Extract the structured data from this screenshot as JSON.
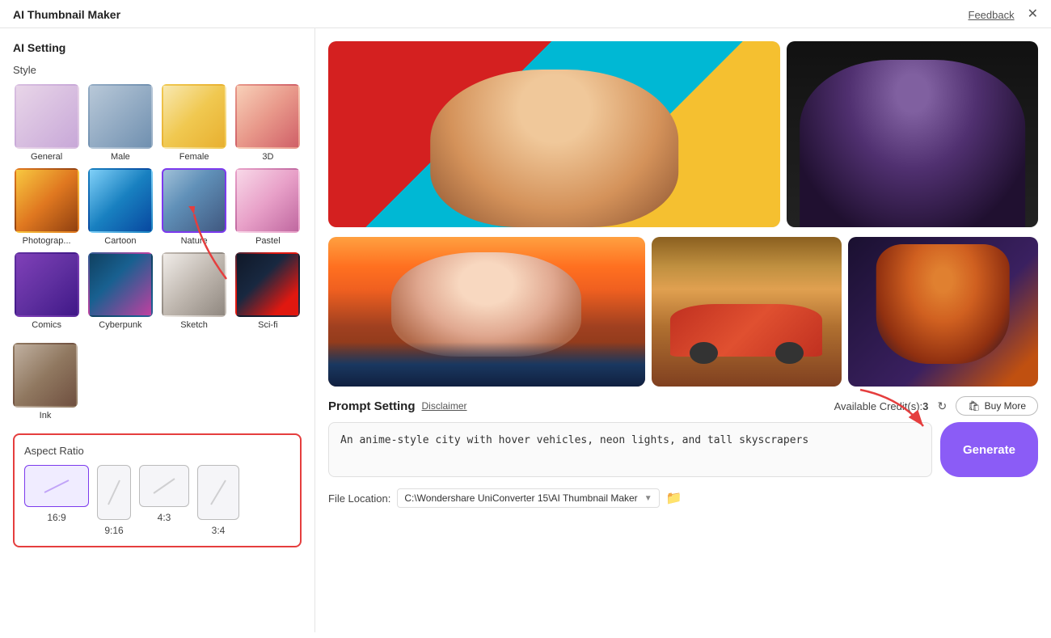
{
  "titleBar": {
    "title": "AI Thumbnail Maker",
    "feedback": "Feedback",
    "close": "✕"
  },
  "leftPanel": {
    "sectionTitle": "AI Setting",
    "styleLabel": "Style",
    "styles": [
      {
        "id": "general",
        "label": "General",
        "selected": false,
        "thumbClass": "thumb-general"
      },
      {
        "id": "male",
        "label": "Male",
        "selected": false,
        "thumbClass": "thumb-male"
      },
      {
        "id": "female",
        "label": "Female",
        "selected": false,
        "thumbClass": "thumb-female"
      },
      {
        "id": "3d",
        "label": "3D",
        "selected": false,
        "thumbClass": "thumb-3d"
      },
      {
        "id": "photography",
        "label": "Photograp...",
        "selected": false,
        "thumbClass": "thumb-photography"
      },
      {
        "id": "cartoon",
        "label": "Cartoon",
        "selected": false,
        "thumbClass": "thumb-cartoon"
      },
      {
        "id": "nature",
        "label": "Nature",
        "selected": true,
        "thumbClass": "thumb-nature"
      },
      {
        "id": "pastel",
        "label": "Pastel",
        "selected": false,
        "thumbClass": "thumb-pastel"
      },
      {
        "id": "comics",
        "label": "Comics",
        "selected": false,
        "thumbClass": "thumb-comics"
      },
      {
        "id": "cyberpunk",
        "label": "Cyberpunk",
        "selected": false,
        "thumbClass": "thumb-cyberpunk"
      },
      {
        "id": "sketch",
        "label": "Sketch",
        "selected": false,
        "thumbClass": "thumb-sketch"
      },
      {
        "id": "scifi",
        "label": "Sci-fi",
        "selected": false,
        "thumbClass": "thumb-scifi"
      }
    ],
    "inkStyle": {
      "id": "ink",
      "label": "Ink",
      "selected": false,
      "thumbClass": "thumb-ink"
    },
    "aspectRatioTitle": "Aspect Ratio",
    "aspectRatios": [
      {
        "id": "16-9",
        "label": "16:9",
        "selected": true
      },
      {
        "id": "9-16",
        "label": "9:16",
        "selected": false
      },
      {
        "id": "4-3",
        "label": "4:3",
        "selected": false
      },
      {
        "id": "3-4",
        "label": "3:4",
        "selected": false
      }
    ]
  },
  "promptSection": {
    "title": "Prompt Setting",
    "disclaimerLabel": "Disclaimer",
    "creditsLabel": "Available Credit(s):",
    "creditsCount": "3",
    "buyMoreLabel": "Buy More",
    "promptValue": "An anime-style city with hover vehicles, neon lights, and tall skyscrapers",
    "generateLabel": "Generate"
  },
  "fileLocation": {
    "label": "File Location:",
    "path": "C:\\Wondershare UniConverter 15\\AI Thumbnail Maker",
    "dropdownSymbol": "▼"
  }
}
